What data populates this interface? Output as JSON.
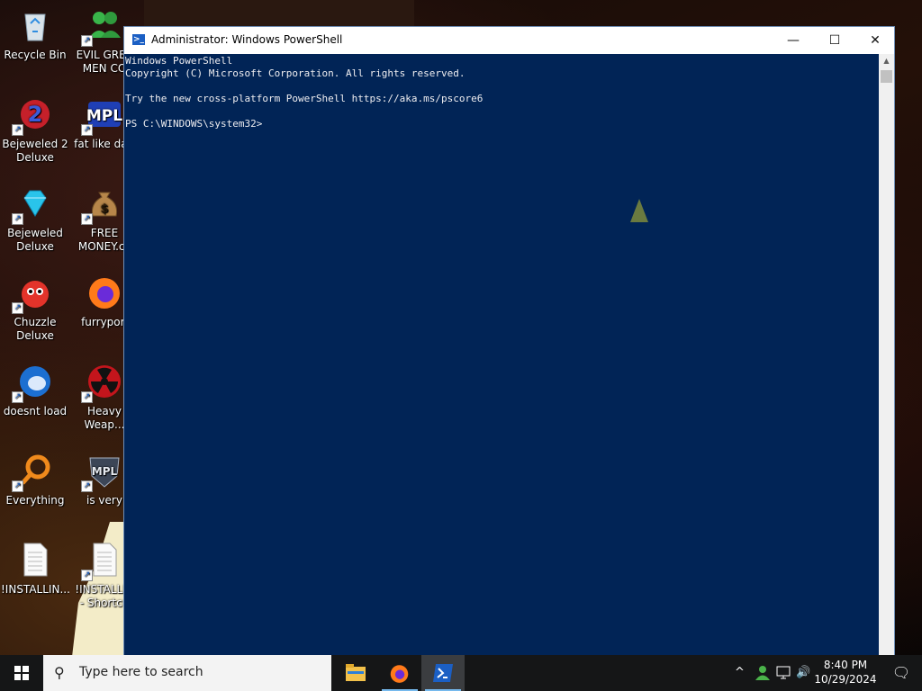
{
  "desktop": {
    "icons": [
      {
        "label": "Recycle Bin",
        "icon": "recycle-bin-icon"
      },
      {
        "label": "EVIL GREE\nMEN CO",
        "icon": "people-icon"
      },
      {
        "label": "Bejeweled 2\nDeluxe",
        "icon": "bejeweled2-icon"
      },
      {
        "label": "fat like darl",
        "icon": "mpl-icon"
      },
      {
        "label": "Bejeweled\nDeluxe",
        "icon": "diamond-icon"
      },
      {
        "label": "FREE\nMONEY.cc",
        "icon": "money-bag-icon"
      },
      {
        "label": "Chuzzle\nDeluxe",
        "icon": "chuzzle-icon"
      },
      {
        "label": "furrypori",
        "icon": "firefox-icon"
      },
      {
        "label": "doesnt load",
        "icon": "thunderbird-icon"
      },
      {
        "label": "Heavy\nWeap...",
        "icon": "radiation-icon"
      },
      {
        "label": "Everything",
        "icon": "everything-search-icon"
      },
      {
        "label": "is very",
        "icon": "mpl-shield-icon"
      },
      {
        "label": "!INSTALLIN...",
        "icon": "text-file-icon"
      },
      {
        "label": "!INSTALLIN\n- Shortcu",
        "icon": "text-file-shortcut-icon"
      }
    ]
  },
  "window": {
    "title": "Administrator: Windows PowerShell",
    "minimize": "—",
    "maximize": "☐",
    "close": "✕",
    "console_lines": [
      "Windows PowerShell",
      "Copyright (C) Microsoft Corporation. All rights reserved.",
      "",
      "Try the new cross-platform PowerShell https://aka.ms/pscore6",
      "",
      "PS C:\\WINDOWS\\system32>"
    ]
  },
  "taskbar": {
    "search_placeholder": "Type here to search",
    "time": "8:40 PM",
    "date": "10/29/2024",
    "apps": [
      "file-explorer-icon",
      "firefox-icon",
      "powershell-icon"
    ],
    "tray_chevron": "^",
    "volume": "🔊",
    "notification": "🗨"
  },
  "colors": {
    "console_bg": "#012456",
    "taskbar_bg": "#151617",
    "accent": "#76b9ed"
  }
}
